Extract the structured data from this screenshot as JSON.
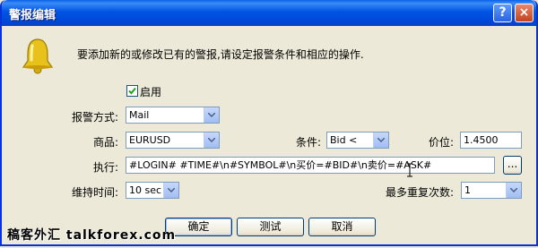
{
  "window": {
    "title": "警报编辑",
    "help_label": "?",
    "close_label": "×"
  },
  "intro_text": "要添加新的或修改已有的警报,请设定报警条件和相应的操作.",
  "enable": {
    "label": "启用",
    "checked": true
  },
  "fields": {
    "action_type": {
      "label": "报警方式:",
      "value": "Mail"
    },
    "symbol": {
      "label": "商品:",
      "value": "EURUSD"
    },
    "condition": {
      "label": "条件:",
      "value": "Bid <"
    },
    "price": {
      "label": "价位:",
      "value": "1.4500"
    },
    "execute": {
      "label": "执行:",
      "value": "#LOGIN# #TIME#\\n#SYMBOL#\\n买价=#BID#\\n卖价=#ASK#",
      "browse_label": "..."
    },
    "timeout": {
      "label": "维持时间:",
      "value": "10 sec"
    },
    "max_repeats": {
      "label": "最多重复次数:",
      "value": "1"
    }
  },
  "buttons": {
    "ok": "确定",
    "test": "测试",
    "cancel": "取消"
  },
  "watermark": "稿客外汇 talkforex.com",
  "colors": {
    "titlebar": "#0054e3",
    "dialog_bg": "#ece9d8",
    "close_btn": "#c2421f",
    "bell": "#e8c21a"
  }
}
